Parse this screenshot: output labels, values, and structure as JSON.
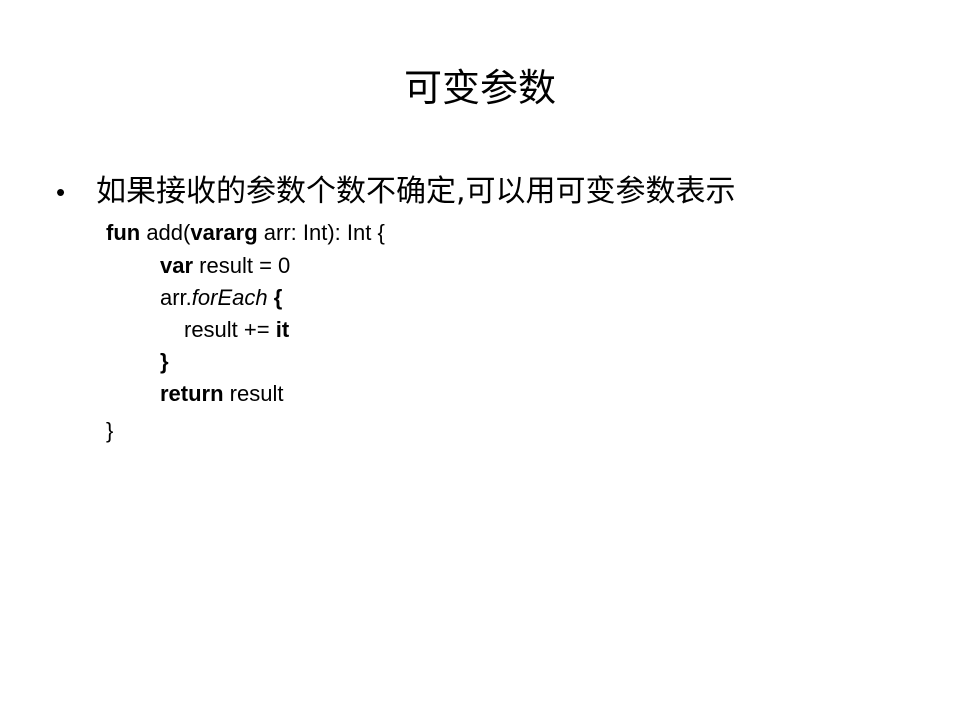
{
  "slide": {
    "title": "可变参数",
    "bullet": "如果接收的参数个数不确定,可以用可变参数表示",
    "bullet_marker": "•",
    "code": {
      "line1": {
        "kw_fun": "fun",
        "t1": " add(",
        "kw_vararg": "vararg",
        "t2": " arr: Int): Int {"
      },
      "line2": {
        "kw_var": "var",
        "t1": " result = 0"
      },
      "line3": {
        "t1": "arr.",
        "method": "forEach",
        "brace": " {"
      },
      "line4": {
        "t1": "result += ",
        "kw_it": "it"
      },
      "line5": {
        "brace": "}"
      },
      "line6": {
        "kw_return": "return",
        "t1": " result"
      },
      "line7": {
        "brace": "}"
      }
    }
  }
}
